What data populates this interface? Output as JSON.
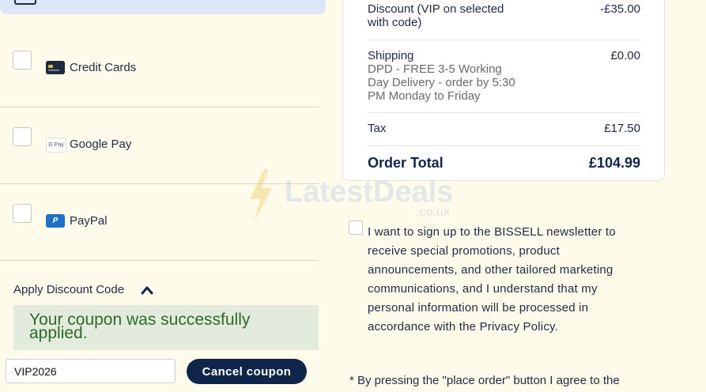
{
  "payment_methods": [
    {
      "label": "Credit Cards",
      "icon": "credit-card-icon"
    },
    {
      "label": "Google Pay",
      "icon": "google-pay-icon",
      "icon_text": "G Pay"
    },
    {
      "label": "PayPal",
      "icon": "paypal-icon",
      "icon_text": "P"
    }
  ],
  "discount": {
    "title": "Apply Discount Code",
    "success_message": "Your coupon was successfully applied.",
    "code_value": "VIP2026",
    "cancel_label": "Cancel coupon"
  },
  "summary": {
    "discount_label": "Discount (VIP on selected with code)",
    "discount_value": "-£35.00",
    "shipping_label": "Shipping",
    "shipping_detail": "DPD - FREE 3-5 Working Day Delivery - order by 5:30 PM Monday to Friday",
    "shipping_value": "£0.00",
    "tax_label": "Tax",
    "tax_value": "£17.50",
    "total_label": "Order Total",
    "total_value": "£104.99"
  },
  "watermark": {
    "text": "LatestDeals",
    "sub": ".co.uk"
  },
  "newsletter_text": "I want to sign up to the BISSELL newsletter to receive special promotions, product announcements, and other tailored marketing communications, and I understand that my personal information will be processed in accordance with the Privacy Policy.",
  "terms_text": "* By pressing the \"place order\" button I agree to the",
  "colors": {
    "accent": "#0f2549",
    "success_bg": "#e2ebdc",
    "success_text": "#2e6b2b",
    "selected_bg": "#dbe7f7",
    "page_bg": "#fffbeb"
  }
}
